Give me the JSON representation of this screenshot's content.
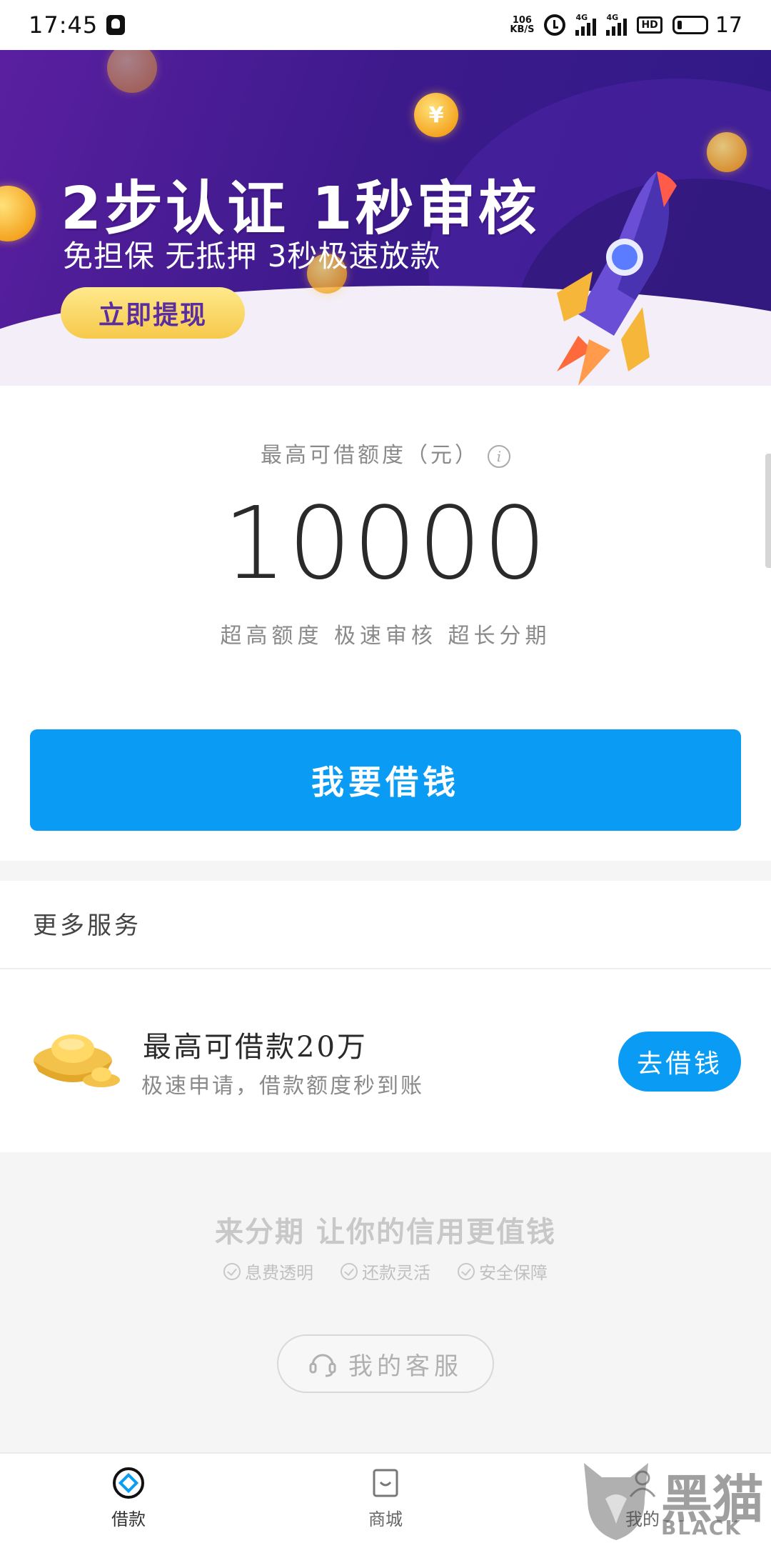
{
  "status_bar": {
    "time": "17:45",
    "net_speed_value": "106",
    "net_speed_unit": "KB/S",
    "signal1_tag": "4G",
    "signal2_tag": "4G",
    "hd_tag": "HD",
    "battery": "17"
  },
  "banner": {
    "title": "2步认证 1秒审核",
    "subtitle": "免担保 无抵押 3秒极速放款",
    "cta": "立即提现",
    "coin_symbol": "¥"
  },
  "quota": {
    "label": "最高可借额度（元）",
    "info_icon": "i",
    "amount": "10000",
    "tags": "超高额度 极速审核 超长分期"
  },
  "primary_button": "我要借钱",
  "more_services": {
    "title": "更多服务",
    "item": {
      "title": "最高可借款20万",
      "desc": "极速申请，借款额度秒到账",
      "button": "去借钱"
    }
  },
  "footer": {
    "slogan": "来分期 让你的信用更值钱",
    "features": [
      "息费透明",
      "还款灵活",
      "安全保障"
    ],
    "customer_service": "我的客服"
  },
  "tabbar": {
    "tabs": [
      {
        "label": "借款",
        "icon": "borrow-icon",
        "active": true
      },
      {
        "label": "商城",
        "icon": "shop-bag-icon",
        "active": false
      },
      {
        "label": "我的",
        "icon": "profile-icon",
        "active": false
      }
    ]
  },
  "watermark": {
    "text": "黑猫",
    "sub": "BLACK CAT"
  },
  "colors": {
    "primary": "#0a9cf5",
    "banner_purple": "#3d1a8c",
    "banner_button": "#f6c94a"
  }
}
